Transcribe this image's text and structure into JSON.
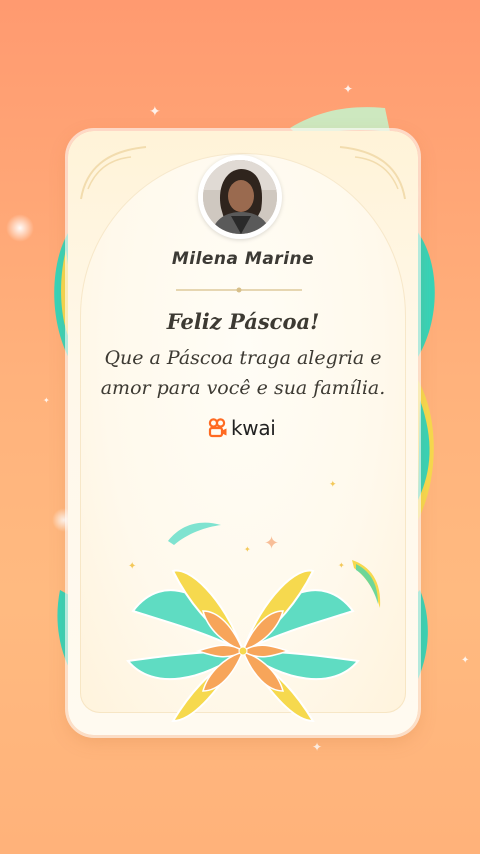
{
  "card": {
    "user_name": "Milena Marine",
    "title": "Feliz Páscoa!",
    "message_line1": "Que a Páscoa traga alegria e",
    "message_line2": "amor para você e sua família.",
    "brand": "kwai"
  },
  "colors": {
    "background_top": "#ff9a70",
    "background_bottom": "#ffb27a",
    "card_bg": "#fff8ea",
    "brand_orange": "#ff6a21",
    "ribbon_teal": "#35d4b8",
    "ribbon_yellow": "#f6d94e"
  },
  "icons": {
    "avatar": "user-avatar",
    "brand_logo": "kwai-logo-icon"
  }
}
